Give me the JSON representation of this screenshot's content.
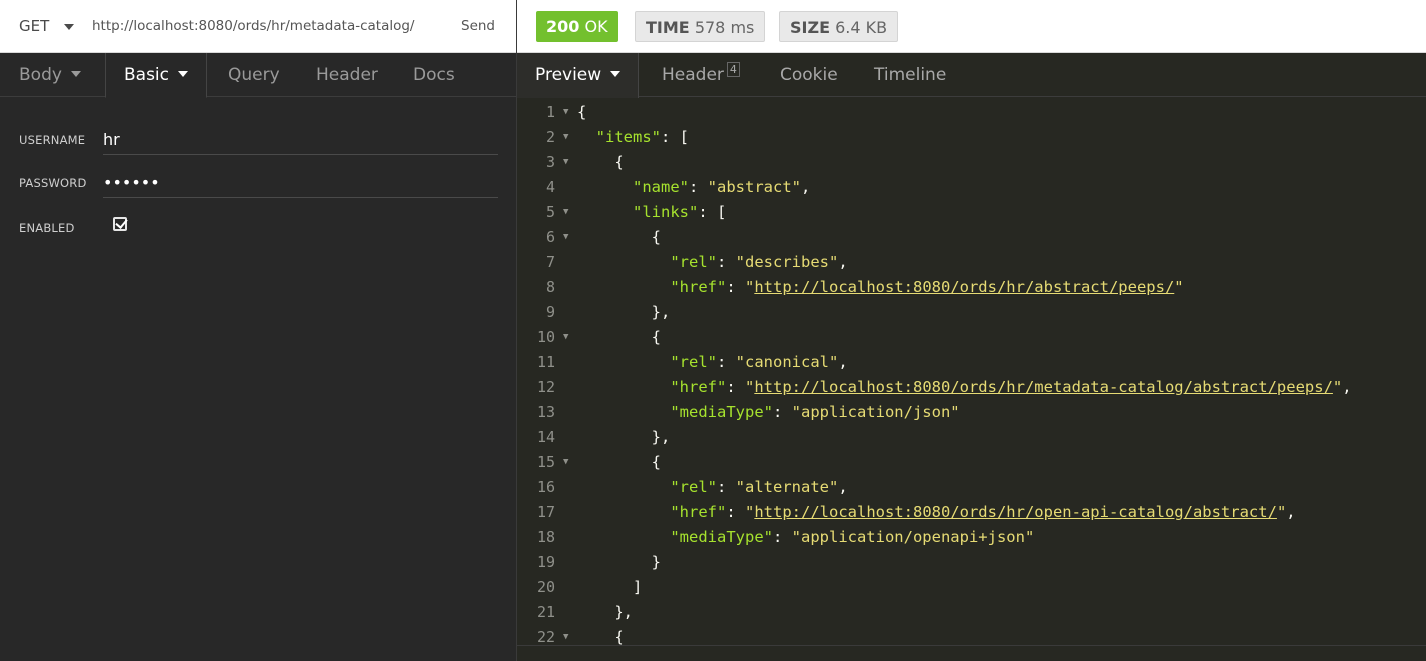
{
  "request": {
    "method": "GET",
    "url": "http://localhost:8080/ords/hr/metadata-catalog/",
    "send_label": "Send"
  },
  "left_tabs": {
    "body": "Body",
    "basic": "Basic",
    "query": "Query",
    "header": "Header",
    "docs": "Docs"
  },
  "auth": {
    "username_label": "USERNAME",
    "username_value": "hr",
    "password_label": "PASSWORD",
    "password_value": "••••••",
    "enabled_label": "ENABLED",
    "enabled": true
  },
  "response": {
    "status_code": "200",
    "status_text": "OK",
    "time_label": "TIME",
    "time_value": "578 ms",
    "size_label": "SIZE",
    "size_value": "6.4 KB",
    "status_color": "#73c02e"
  },
  "right_tabs": {
    "preview": "Preview",
    "header": "Header",
    "header_count": "4",
    "cookie": "Cookie",
    "timeline": "Timeline"
  },
  "code_lines": [
    {
      "n": "1",
      "fold": true,
      "t": [
        [
          "p",
          "{"
        ]
      ]
    },
    {
      "n": "2",
      "fold": true,
      "t": [
        [
          "p",
          "  "
        ],
        [
          "k",
          "\"items\""
        ],
        [
          "p",
          ": ["
        ]
      ]
    },
    {
      "n": "3",
      "fold": true,
      "t": [
        [
          "p",
          "    {"
        ]
      ]
    },
    {
      "n": "4",
      "fold": false,
      "t": [
        [
          "p",
          "      "
        ],
        [
          "k",
          "\"name\""
        ],
        [
          "p",
          ": "
        ],
        [
          "s",
          "\"abstract\""
        ],
        [
          "p",
          ","
        ]
      ]
    },
    {
      "n": "5",
      "fold": true,
      "t": [
        [
          "p",
          "      "
        ],
        [
          "k",
          "\"links\""
        ],
        [
          "p",
          ": ["
        ]
      ]
    },
    {
      "n": "6",
      "fold": true,
      "t": [
        [
          "p",
          "        {"
        ]
      ]
    },
    {
      "n": "7",
      "fold": false,
      "t": [
        [
          "p",
          "          "
        ],
        [
          "k",
          "\"rel\""
        ],
        [
          "p",
          ": "
        ],
        [
          "s",
          "\"describes\""
        ],
        [
          "p",
          ","
        ]
      ]
    },
    {
      "n": "8",
      "fold": false,
      "t": [
        [
          "p",
          "          "
        ],
        [
          "k",
          "\"href\""
        ],
        [
          "p",
          ": "
        ],
        [
          "s",
          "\""
        ],
        [
          "u",
          "http://localhost:8080/ords/hr/abstract/peeps/"
        ],
        [
          "s",
          "\""
        ]
      ]
    },
    {
      "n": "9",
      "fold": false,
      "t": [
        [
          "p",
          "        },"
        ]
      ]
    },
    {
      "n": "10",
      "fold": true,
      "t": [
        [
          "p",
          "        {"
        ]
      ]
    },
    {
      "n": "11",
      "fold": false,
      "t": [
        [
          "p",
          "          "
        ],
        [
          "k",
          "\"rel\""
        ],
        [
          "p",
          ": "
        ],
        [
          "s",
          "\"canonical\""
        ],
        [
          "p",
          ","
        ]
      ]
    },
    {
      "n": "12",
      "fold": false,
      "t": [
        [
          "p",
          "          "
        ],
        [
          "k",
          "\"href\""
        ],
        [
          "p",
          ": "
        ],
        [
          "s",
          "\""
        ],
        [
          "u",
          "http://localhost:8080/ords/hr/metadata-catalog/abstract/peeps/"
        ],
        [
          "s",
          "\""
        ],
        [
          "p",
          ","
        ]
      ]
    },
    {
      "n": "13",
      "fold": false,
      "t": [
        [
          "p",
          "          "
        ],
        [
          "k",
          "\"mediaType\""
        ],
        [
          "p",
          ": "
        ],
        [
          "s",
          "\"application/json\""
        ]
      ]
    },
    {
      "n": "14",
      "fold": false,
      "t": [
        [
          "p",
          "        },"
        ]
      ]
    },
    {
      "n": "15",
      "fold": true,
      "t": [
        [
          "p",
          "        {"
        ]
      ]
    },
    {
      "n": "16",
      "fold": false,
      "t": [
        [
          "p",
          "          "
        ],
        [
          "k",
          "\"rel\""
        ],
        [
          "p",
          ": "
        ],
        [
          "s",
          "\"alternate\""
        ],
        [
          "p",
          ","
        ]
      ]
    },
    {
      "n": "17",
      "fold": false,
      "t": [
        [
          "p",
          "          "
        ],
        [
          "k",
          "\"href\""
        ],
        [
          "p",
          ": "
        ],
        [
          "s",
          "\""
        ],
        [
          "u",
          "http://localhost:8080/ords/hr/open-api-catalog/abstract/"
        ],
        [
          "s",
          "\""
        ],
        [
          "p",
          ","
        ]
      ]
    },
    {
      "n": "18",
      "fold": false,
      "t": [
        [
          "p",
          "          "
        ],
        [
          "k",
          "\"mediaType\""
        ],
        [
          "p",
          ": "
        ],
        [
          "s",
          "\"application/openapi+json\""
        ]
      ]
    },
    {
      "n": "19",
      "fold": false,
      "t": [
        [
          "p",
          "        }"
        ]
      ]
    },
    {
      "n": "20",
      "fold": false,
      "t": [
        [
          "p",
          "      ]"
        ]
      ]
    },
    {
      "n": "21",
      "fold": false,
      "t": [
        [
          "p",
          "    },"
        ]
      ]
    },
    {
      "n": "22",
      "fold": true,
      "t": [
        [
          "p",
          "    {"
        ]
      ]
    }
  ],
  "colors": {
    "json_key": "#a6e22e",
    "json_string": "#e6db74",
    "editor_bg": "#272822"
  }
}
